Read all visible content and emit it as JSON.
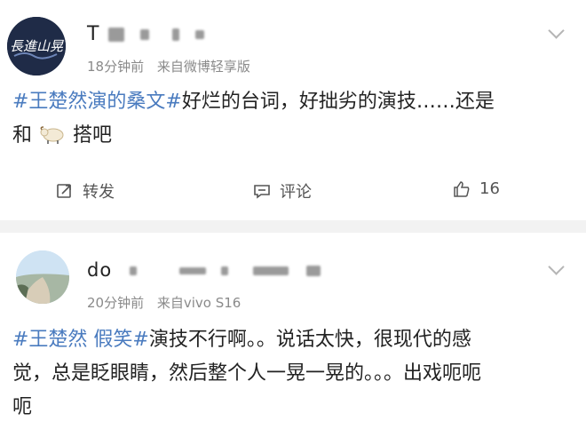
{
  "post1": {
    "avatar_text": "長進山晃",
    "username": "T",
    "time": "18分钟前",
    "source": "来自微博轻享版",
    "hashtag": "#王楚然演的桑文#",
    "text_line1": "好烂的台词，好拙劣的演技……还是",
    "text_line2_a": "和",
    "text_line2_b": "搭吧",
    "sheep_icon": "sheep-emoji",
    "actions": {
      "repost_label": "转发",
      "comment_label": "评论",
      "like_count": "16"
    }
  },
  "post2": {
    "username": "do",
    "time": "20分钟前",
    "source": "来自vivo S16",
    "hashtag": "#王楚然 假笑#",
    "text_line1": "演技不行啊。。说话太快，很现代的感",
    "text_line2": "觉，总是眨眼睛，然后整个人一晃一晃的。。。出戏呃呃",
    "text_line3": "呃"
  },
  "colors": {
    "hashtag": "#4a7bbf",
    "meta": "#8a8a8a",
    "background": "#f2f2f2"
  }
}
